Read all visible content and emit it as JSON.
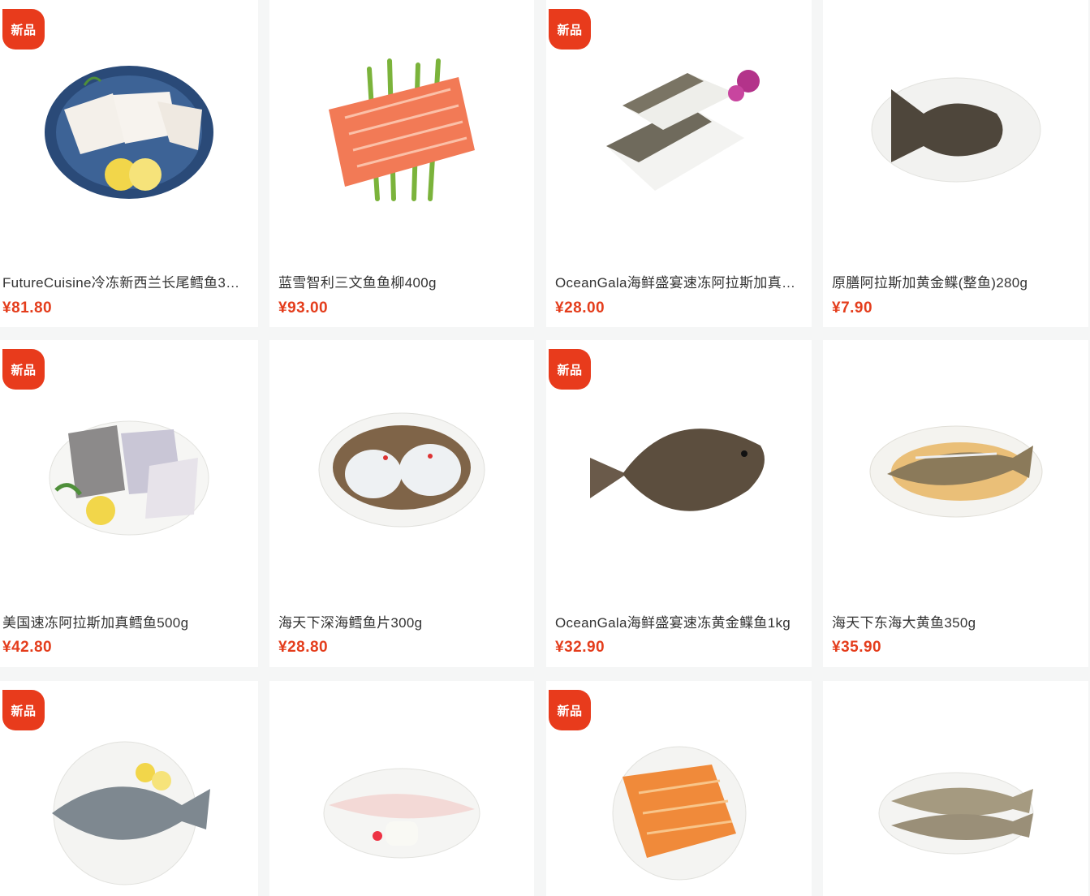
{
  "badge_label": "新品",
  "colors": {
    "accent": "#e83b1c",
    "price": "#e43d1c",
    "background": "#f5f6f6"
  },
  "products": [
    {
      "title": "FutureCuisine冷冻新西兰长尾鳕鱼3…",
      "price": "¥81.80",
      "is_new": true,
      "image": "cod-fillet-blue-plate"
    },
    {
      "title": "蓝雪智利三文鱼鱼柳400g",
      "price": "¥93.00",
      "is_new": false,
      "image": "salmon-fillet-asparagus"
    },
    {
      "title": "OceanGala海鲜盛宴速冻阿拉斯加真…",
      "price": "¥28.00",
      "is_new": true,
      "image": "flatfish-fillets-orchid"
    },
    {
      "title": "原膳阿拉斯加黄金鲽(整鱼)280g",
      "price": "¥7.90",
      "is_new": false,
      "image": "whole-flounder-plate"
    },
    {
      "title": "美国速冻阿拉斯加真鳕鱼500g",
      "price": "¥42.80",
      "is_new": true,
      "image": "cod-pieces-lemon"
    },
    {
      "title": "海天下深海鳕鱼片300g",
      "price": "¥28.80",
      "is_new": false,
      "image": "steamed-cod-bowl"
    },
    {
      "title": "OceanGala海鲜盛宴速冻黄金鲽鱼1kg",
      "price": "¥32.90",
      "is_new": true,
      "image": "whole-flounder"
    },
    {
      "title": "海天下东海大黄鱼350g",
      "price": "¥35.90",
      "is_new": false,
      "image": "braised-croaker-plate"
    },
    {
      "title": "",
      "price": "",
      "is_new": true,
      "image": "pomfret-plate-lemon"
    },
    {
      "title": "",
      "price": "",
      "is_new": false,
      "image": "basa-fillet-plate"
    },
    {
      "title": "",
      "price": "",
      "is_new": true,
      "image": "smoked-fillet-plate"
    },
    {
      "title": "",
      "price": "",
      "is_new": false,
      "image": "yellow-croaker-plate"
    }
  ]
}
